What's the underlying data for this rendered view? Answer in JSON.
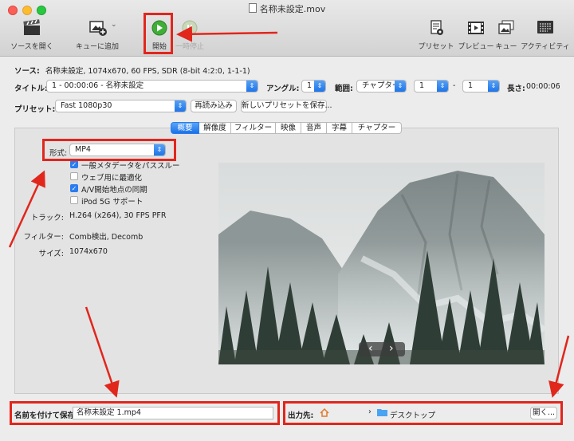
{
  "window": {
    "title": "名称未設定.mov"
  },
  "toolbar": {
    "open_source": "ソースを開く",
    "add_queue": "キューに追加",
    "start": "開始",
    "pause": "一時停止",
    "presets": "プリセット",
    "preview": "プレビュー",
    "queue": "キュー",
    "activity": "アクティビティ"
  },
  "source": {
    "label": "ソース:",
    "value": "名称未設定, 1074x670, 60 FPS, SDR (8-bit 4:2:0, 1-1-1)"
  },
  "title_row": {
    "title_label": "タイトル:",
    "title_value": "1 - 00:00:06 - 名称未設定",
    "angle_label": "アングル:",
    "angle_value": "1",
    "range_label": "範囲:",
    "range_type": "チャプター",
    "range_start": "1",
    "range_dash": "-",
    "range_end": "1",
    "length_label": "長さ:",
    "length_value": "00:00:06"
  },
  "preset_row": {
    "label": "プリセット:",
    "value": "Fast 1080p30",
    "reload_button": "再読み込み",
    "save_new_button": "新しいプリセットを保存..."
  },
  "tabs": [
    "概要",
    "解像度",
    "フィルター",
    "映像",
    "音声",
    "字幕",
    "チャプター"
  ],
  "summary": {
    "format_label": "形式:",
    "format_value": "MP4",
    "options": [
      {
        "label": "一般メタデータをパススルー",
        "checked": true
      },
      {
        "label": "ウェブ用に最適化",
        "checked": false
      },
      {
        "label": "A/V開始地点の同期",
        "checked": true
      },
      {
        "label": "iPod 5G サポート",
        "checked": false
      }
    ],
    "track_label": "トラック:",
    "track_value": "H.264 (x264), 30 FPS PFR",
    "filter_label": "フィルター:",
    "filter_value": "Comb検出, Decomb",
    "size_label": "サイズ:",
    "size_value": "1074x670"
  },
  "preview_nav": {
    "prev": "‹",
    "next": "›"
  },
  "bottom": {
    "save_as_label": "名前を付けて保存:",
    "save_as_value": "名称未設定 1.mp4",
    "dest_label": "出力先:",
    "dest_folder": "デスクトップ",
    "browse_button": "開く..."
  },
  "colors": {
    "annotation": "#e1261c",
    "accent": "#2a7cf0"
  }
}
